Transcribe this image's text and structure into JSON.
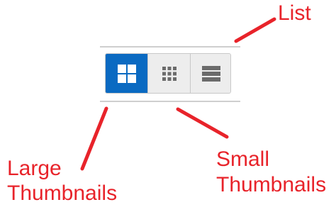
{
  "toolbar": {
    "buttons": [
      {
        "id": "large-thumbnails",
        "icon": "large-grid-icon",
        "active": true
      },
      {
        "id": "small-thumbnails",
        "icon": "small-grid-icon",
        "active": false
      },
      {
        "id": "list",
        "icon": "list-icon",
        "active": false
      }
    ],
    "active_color": "#0a6ac2",
    "inactive_color": "#ededed",
    "icon_color_inactive": "#6b6b6b"
  },
  "annotations": {
    "color": "#e8232a",
    "list_label": "List",
    "large_line1": "Large",
    "large_line2": "Thumbnails",
    "small_line1": "Small",
    "small_line2": "Thumbnails"
  }
}
